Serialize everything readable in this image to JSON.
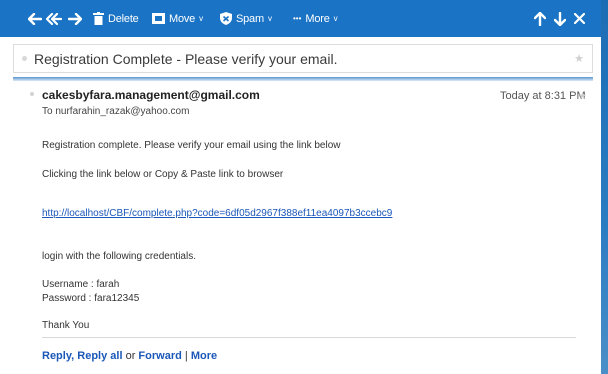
{
  "toolbar": {
    "delete_label": "Delete",
    "move_label": "Move",
    "spam_label": "Spam",
    "more_label": "More",
    "caret": "v",
    "more_dots": "•••"
  },
  "subject": {
    "text": "Registration Complete - Please verify your email."
  },
  "message": {
    "sender": "cakesbyfara.management@gmail.com",
    "to": "To  nurfarahin_razak@yahoo.com",
    "timestamp": "Today at 8:31 PM",
    "lines": {
      "intro": "Registration complete. Please verify your email using the link below",
      "instruction": "Clicking the link below or Copy & Paste link to browser",
      "link": "http://localhost/CBF/complete.php?code=6df05d2967f388ef11ea4097b3ccebc9",
      "credentials_intro": "login with the following credentials.",
      "username": "Username : farah",
      "password": "Password : fara12345",
      "thanks": "Thank You"
    }
  },
  "footer": {
    "reply": "Reply",
    "reply_all": "Reply all",
    "or": "or",
    "forward": "Forward",
    "more": "More",
    "pipe": "|"
  },
  "colors": {
    "toolbar_bg": "#1a73c4",
    "link": "#1a57b8"
  }
}
